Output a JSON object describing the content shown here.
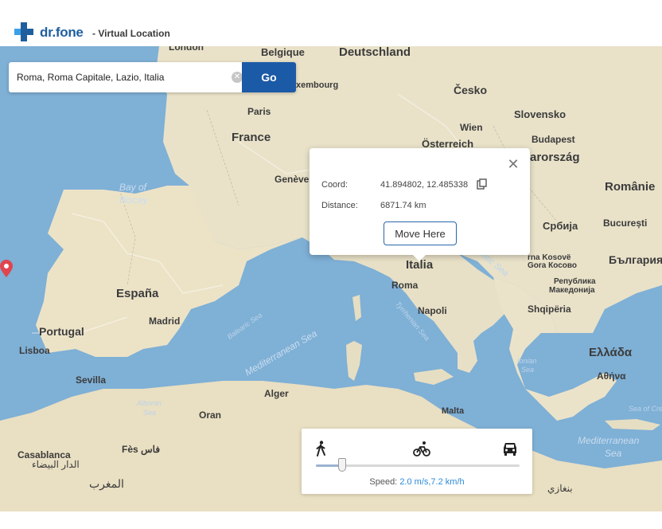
{
  "app": {
    "brand": "dr.fone",
    "subtitle": "- Virtual Location",
    "brand_color": "#1f5f9e"
  },
  "search": {
    "value": "Roma, Roma Capitale, Lazio, Italia",
    "go_label": "Go",
    "clear_icon": "clear-circle-icon",
    "go_color": "#1b5aa6"
  },
  "popup": {
    "coord_label": "Coord:",
    "coord_value": "41.894802, 12.485338",
    "distance_label": "Distance:",
    "distance_value": "6871.74 km",
    "move_button": "Move Here",
    "close_icon": "close-icon",
    "copy_icon": "copy-icon"
  },
  "speed": {
    "label": "Speed:",
    "value": "2.0 m/s,7.2 km/h",
    "modes": [
      "walk-icon",
      "bike-icon",
      "car-icon"
    ],
    "slider_fraction": 0.13,
    "value_color": "#2b8ad8"
  },
  "map": {
    "labels": {
      "london": "London",
      "belgique": "Belgique",
      "deutschland": "Deutschland",
      "luxembourg": "xembourg",
      "cesko": "Česko",
      "paris": "Paris",
      "france": "France",
      "wien": "Wien",
      "slovensko": "Slovensko",
      "osterreich": "Österreich",
      "budapest": "Budapest",
      "magyarorszag": "arország",
      "geneve": "Genève",
      "romania": "Românie",
      "bay_of_biscay_1": "Bay of",
      "bay_of_biscay_2": "Biscay",
      "srbija": "Србија",
      "bucuresti": "București",
      "kosovo1": "rna Kosovë",
      "kosovo2": "Gora Косово",
      "republika": "Република",
      "makedonija": "Македонија",
      "balgariya": "България",
      "italia": "Italia",
      "roma": "Roma",
      "espana": "España",
      "madrid": "Madrid",
      "napoli": "Napoli",
      "shqiperia": "Shqipëria",
      "portugal": "Portugal",
      "lisboa": "Lisboa",
      "balearic": "Balearic Sea",
      "tyrrhenian": "Tyrrhenian Sea",
      "adriatic": "Adriatic Sea",
      "mediterranean": "Mediterranean Sea",
      "ellada": "Ελλάδα",
      "athina": "Αθήνα",
      "sevilla": "Sevilla",
      "alger": "Alger",
      "ionian1": "Ionian",
      "ionian2": "Sea",
      "alboran1": "Alboran",
      "alboran2": "Sea",
      "oran": "Oran",
      "malta": "Malta",
      "sea_of_crete": "Sea of Crete",
      "casablanca": "Casablanca",
      "casablanca_ar": "الدار البيضاء",
      "fes": "Fès فاس",
      "maghreb": "المغرب",
      "med_east1": "Mediterranean",
      "med_east2": "Sea",
      "benghazi": "بنغازي"
    },
    "water_color": "#7fb0d6",
    "land_color": "#eee6cf"
  }
}
